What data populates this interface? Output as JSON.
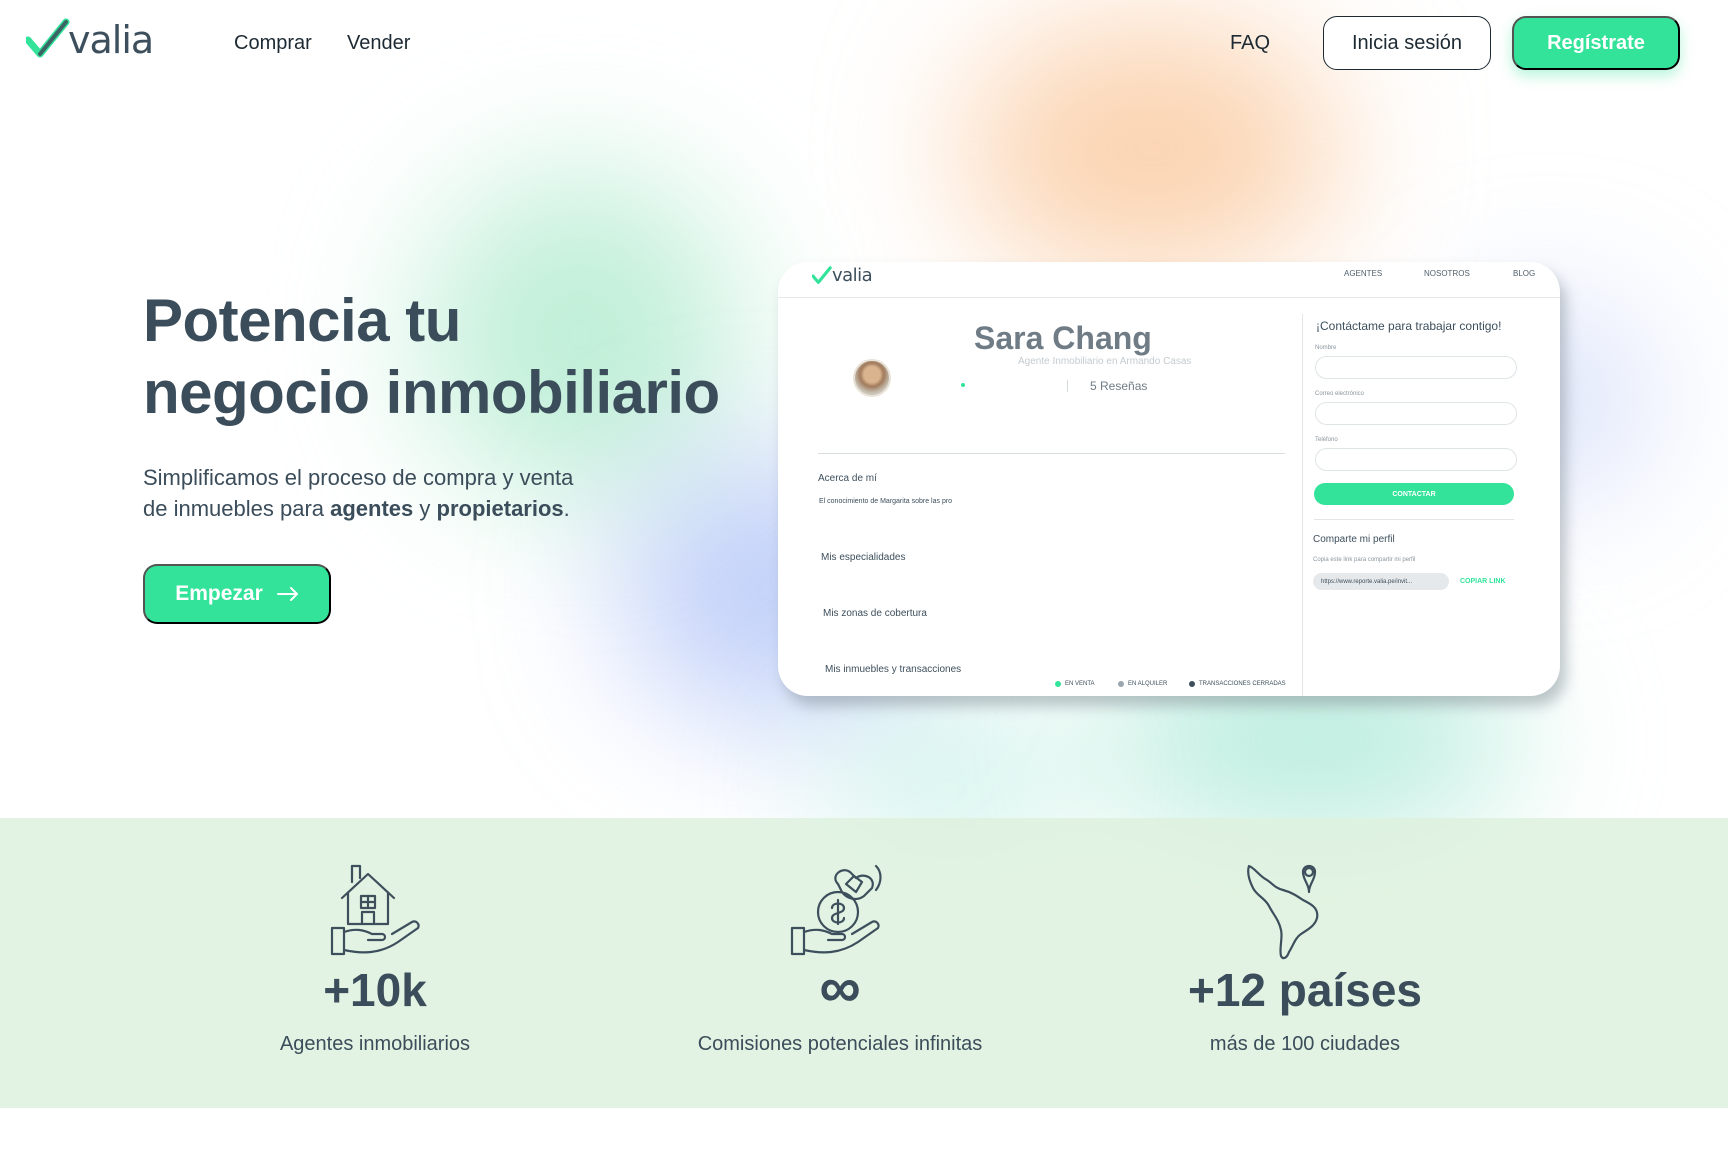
{
  "brand": {
    "name": "valia",
    "accent": "#33e39a",
    "text_color": "#3b4d5a"
  },
  "nav": {
    "comprar": "Comprar",
    "vender": "Vender",
    "faq": "FAQ",
    "login": "Inicia sesión",
    "register": "Regístrate"
  },
  "hero": {
    "title_line1": "Potencia tu",
    "title_line2": "negocio inmobiliario",
    "sub_line1": "Simplificamos el proceso de compra y venta",
    "sub_prefix": "de inmuebles para ",
    "sub_agents": "agentes",
    "sub_and": " y ",
    "sub_owners": "propietarios",
    "sub_end": ".",
    "cta": "Empezar",
    "cta_icon": "arrow-right-icon"
  },
  "mockup": {
    "logo": "valia",
    "nav": [
      "AGENTES",
      "NOSOTROS",
      "BLOG"
    ],
    "profile_name": "Sara Chang",
    "profile_title": "Agente Inmobiliario en Armando Casas",
    "reviews": "5 Reseñas",
    "about_heading": "Acerca de mí",
    "about_text": "El conocimiento de Margarita sobre las pro",
    "specialties": "Mis especialidades",
    "coverage": "Mis zonas de cobertura",
    "properties": "Mis inmuebles y transacciones",
    "legend": [
      {
        "label": "EN VENTA",
        "color": "#33e39a"
      },
      {
        "label": "EN ALQUILER",
        "color": "#9aa6b0"
      },
      {
        "label": "TRANSACCIONES CERRADAS",
        "color": "#3d4f5c"
      }
    ],
    "contact_title": "¡Contáctame para trabajar contigo!",
    "field_name": "Nombre",
    "field_email": "Correo electrónico",
    "field_phone": "Teléfono",
    "contact_button": "CONTACTAR",
    "share_title": "Comparte mi perfil",
    "share_sub": "Copia este link para compartir mi perfil",
    "share_link": "https://www.reporte.valia.pe/invit...",
    "copy_link": "COPIAR LINK"
  },
  "stats": [
    {
      "value": "+10k",
      "label": "Agentes inmobiliarios",
      "icon": "house-in-hand-icon"
    },
    {
      "value": "∞",
      "label": "Comisiones potenciales infinitas",
      "icon": "money-in-hand-icon"
    },
    {
      "value": "+12 países",
      "label": "más de 100 ciudades",
      "icon": "latin-america-map-pin-icon"
    }
  ]
}
